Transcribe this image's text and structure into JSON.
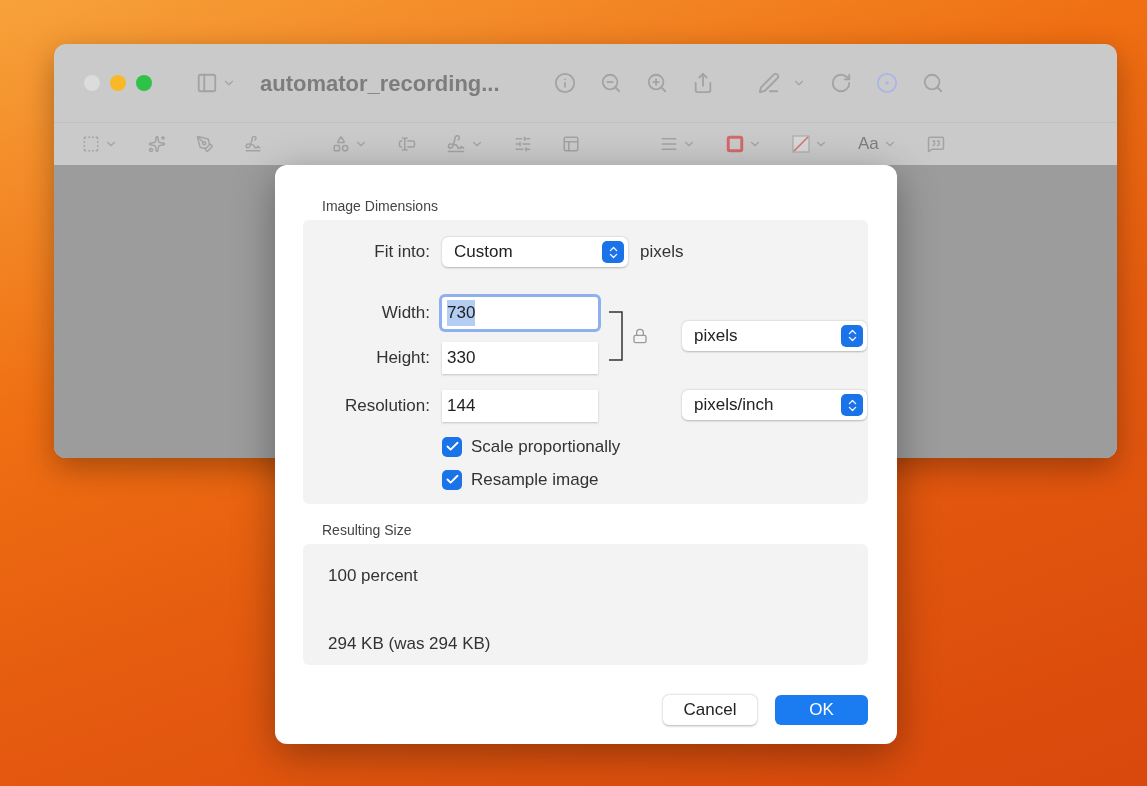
{
  "window": {
    "title": "automator_recording...",
    "toolbar_font_label": "Aa"
  },
  "dialog": {
    "image_dimensions": {
      "title": "Image Dimensions",
      "fit_into": {
        "label": "Fit into:",
        "value": "Custom",
        "unit": "pixels"
      },
      "width": {
        "label": "Width:",
        "value": "730",
        "focused": true
      },
      "height": {
        "label": "Height:",
        "value": "330",
        "focused": false
      },
      "size_unit": "pixels",
      "resolution": {
        "label": "Resolution:",
        "value": "144",
        "unit": "pixels/inch"
      },
      "checkboxes": [
        {
          "label": "Scale proportionally",
          "checked": true
        },
        {
          "label": "Resample image",
          "checked": true
        }
      ]
    },
    "resulting_size": {
      "title": "Resulting Size",
      "lines": [
        "100 percent",
        "294 KB (was 294 KB)"
      ]
    },
    "buttons": [
      {
        "label": "Cancel",
        "kind": "secondary"
      },
      {
        "label": "OK",
        "kind": "default"
      }
    ]
  }
}
